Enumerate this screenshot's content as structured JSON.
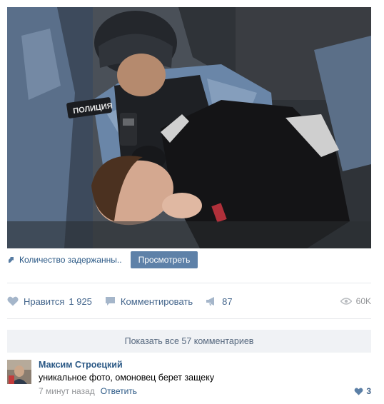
{
  "post": {
    "photo_icon": "photo-image",
    "attachment": {
      "icon": "link-arrow-icon",
      "text": "Количество задержанны..",
      "button_label": "Просмотреть"
    },
    "actions": {
      "like_label": "Нравится",
      "like_count": "1 925",
      "comment_label": "Комментировать",
      "share_count": "87",
      "views": "60K"
    },
    "show_all_label": "Показать все 57 комментариев"
  },
  "comment": {
    "author": "Максим Строецкий",
    "text": "уникальное фото, омоновец берет защеку",
    "time": "7 минут назад",
    "reply_label": "Ответить",
    "likes": "3"
  },
  "colors": {
    "link": "#2a5885",
    "button": "#5e81a8",
    "action": "#42648b",
    "muted": "#939598",
    "panel": "#f0f2f5"
  }
}
